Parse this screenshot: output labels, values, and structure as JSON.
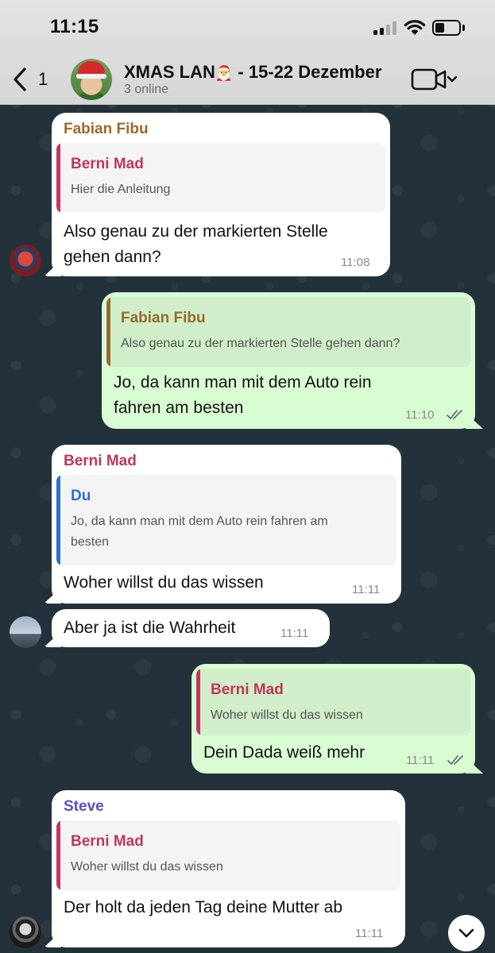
{
  "status_bar": {
    "time": "11:15"
  },
  "header": {
    "back_count": "1",
    "group_name": "XMAS LAN",
    "group_emoji": "🎅",
    "group_dates": " - 15-22 Dezember",
    "subtitle": "3 online"
  },
  "colors": {
    "fabian": "#9a6a2c",
    "berni": "#c0365d",
    "du": "#2e6fc9",
    "steve": "#5a4fc4",
    "out_bubble": "#d9fdd3",
    "in_bubble": "#ffffff",
    "read_ticks": "#5f6b73"
  },
  "messages": [
    {
      "sender": "Fabian Fibu",
      "quote_name": "Berni Mad",
      "quote_text": "Hier die Anleitung",
      "line1": "Also genau zu der markierten Stelle",
      "line2": "gehen dann?",
      "time": "11:08"
    },
    {
      "quote_name": "Fabian Fibu",
      "quote_text": "Also genau zu der markierten Stelle gehen dann?",
      "line1": "Jo, da kann man mit dem Auto rein",
      "line2": "fahren am besten",
      "time": "11:10"
    },
    {
      "sender": "Berni Mad",
      "quote_name": "Du",
      "quote_line1": "Jo, da kann man mit dem Auto rein fahren am",
      "quote_line2": "besten",
      "text": "Woher willst du das wissen",
      "time": "11:11"
    },
    {
      "text": "Aber ja ist die Wahrheit",
      "time": "11:11"
    },
    {
      "quote_name": "Berni Mad",
      "quote_text": "Woher willst du das wissen",
      "text": "Dein Dada weiß mehr",
      "time": "11:11"
    },
    {
      "sender": "Steve",
      "quote_name": "Berni Mad",
      "quote_text": "Woher willst du das wissen",
      "text": "Der holt da jeden Tag deine Mutter ab",
      "time": "11:11"
    }
  ]
}
